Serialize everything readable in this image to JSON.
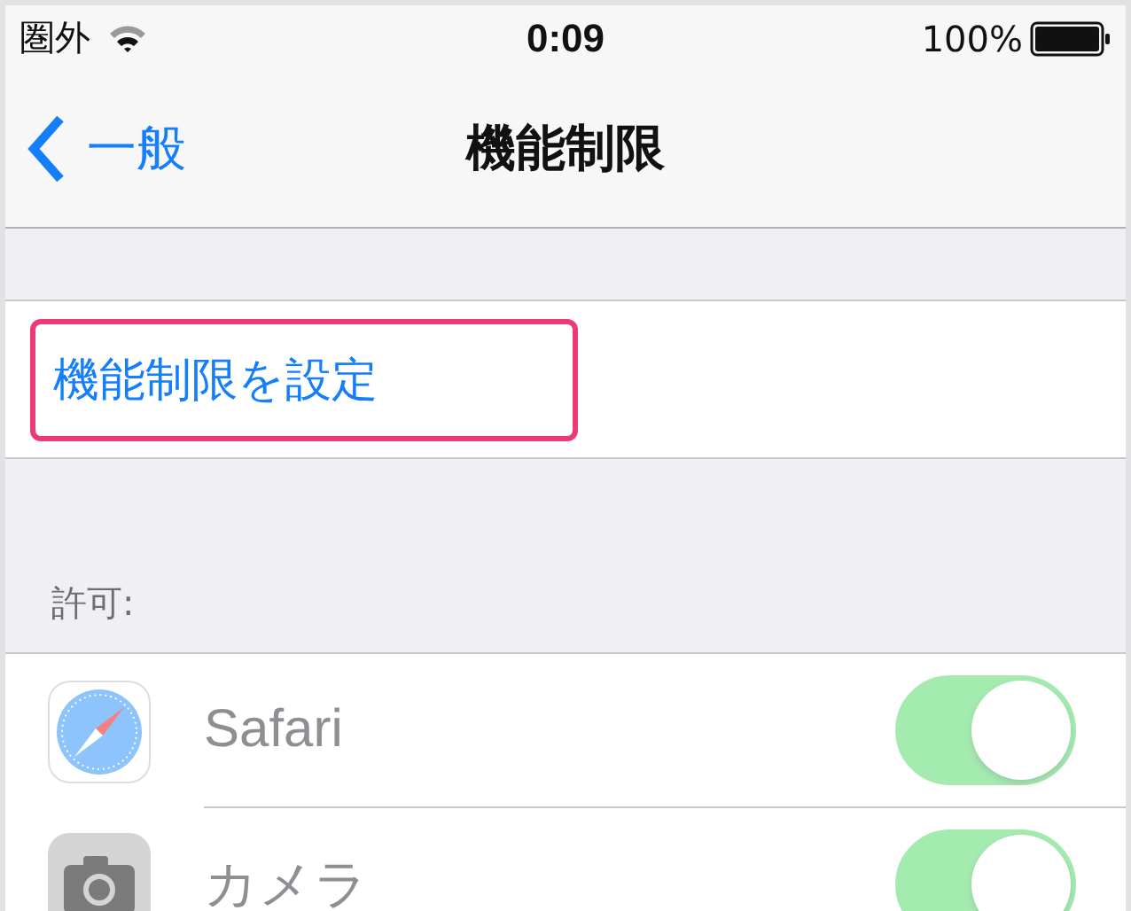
{
  "status_bar": {
    "carrier": "圏外",
    "time": "0:09",
    "battery": "100%"
  },
  "nav": {
    "back": "一般",
    "title": "機能制限"
  },
  "action": {
    "label": "機能制限を設定",
    "highlighted": true
  },
  "section_header": "許可:",
  "rows": [
    {
      "label": "Safari",
      "kind": "compass",
      "on": true,
      "disabled": true
    },
    {
      "label": "カメラ",
      "kind": "camera",
      "on": true,
      "disabled": true
    }
  ]
}
